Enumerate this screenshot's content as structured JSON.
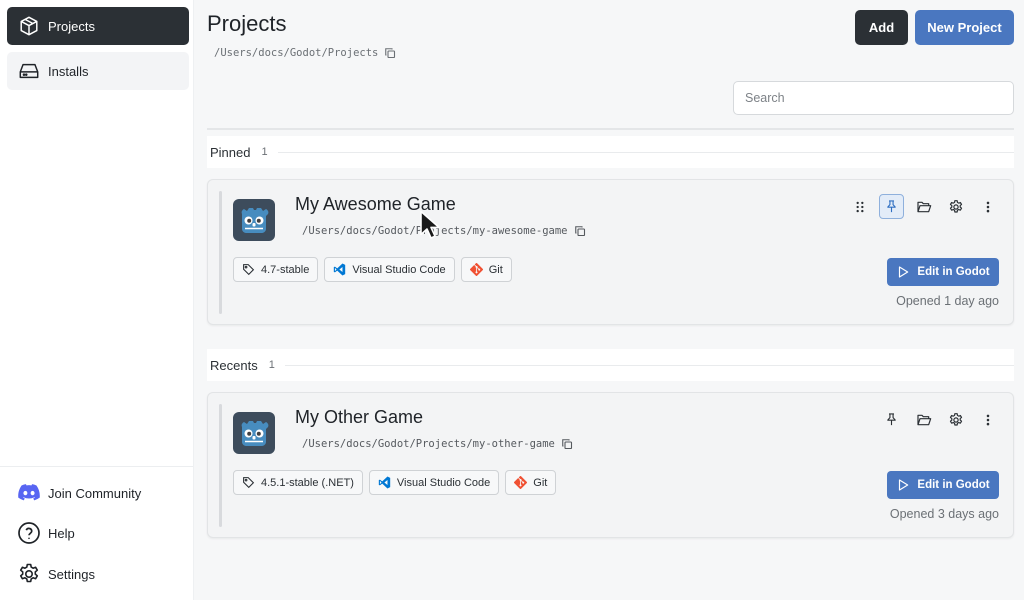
{
  "sidebar": {
    "nav": [
      {
        "label": "Projects",
        "icon": "cube-icon",
        "active": true
      },
      {
        "label": "Installs",
        "icon": "drive-icon",
        "active": false
      }
    ],
    "footer": [
      {
        "label": "Join Community",
        "icon": "discord-icon"
      },
      {
        "label": "Help",
        "icon": "help-icon"
      },
      {
        "label": "Settings",
        "icon": "gear-icon"
      }
    ]
  },
  "header": {
    "title": "Projects",
    "path": "/Users/docs/Godot/Projects",
    "add_label": "Add",
    "new_project_label": "New Project"
  },
  "search": {
    "placeholder": "Search",
    "value": ""
  },
  "sections": {
    "pinned": {
      "label": "Pinned",
      "count": "1"
    },
    "recents": {
      "label": "Recents",
      "count": "1"
    }
  },
  "projects": [
    {
      "name": "My Awesome Game",
      "path": "/Users/docs/Godot/Projects/my-awesome-game",
      "version": "4.7-stable",
      "editor": "Visual Studio Code",
      "vcs": "Git",
      "pinned": true,
      "edit_label": "Edit in Godot",
      "opened": "Opened 1 day ago"
    },
    {
      "name": "My Other Game",
      "path": "/Users/docs/Godot/Projects/my-other-game",
      "version": "4.5.1-stable (.NET)",
      "editor": "Visual Studio Code",
      "vcs": "Git",
      "pinned": false,
      "edit_label": "Edit in Godot",
      "opened": "Opened 3 days ago"
    }
  ],
  "colors": {
    "accent": "#4a77c0",
    "dark": "#2b3035",
    "godot": "#478cbf",
    "git": "#f05133",
    "vscode": "#0078d4"
  }
}
